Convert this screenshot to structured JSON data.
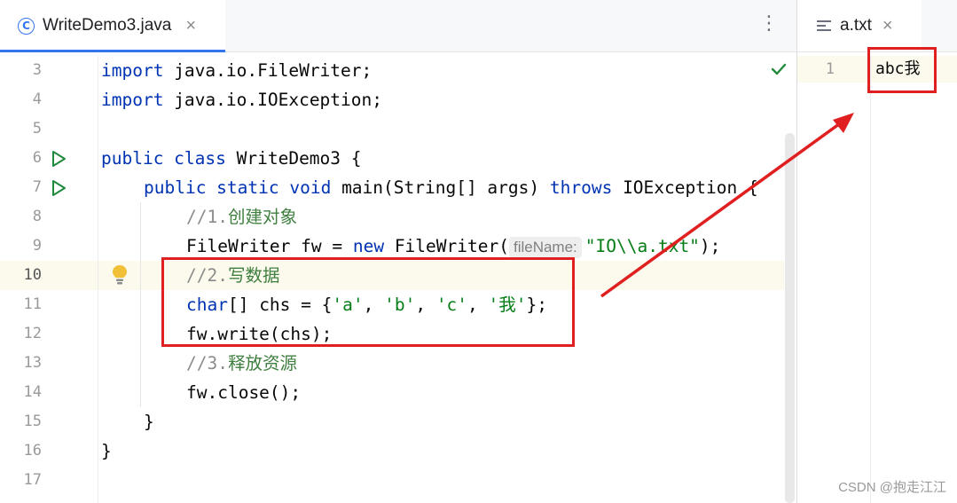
{
  "editor": {
    "tab_label": "WriteDemo3.java",
    "tab_close": "×",
    "more_icon": "⋮",
    "class_icon_letter": "C",
    "gutter_lines": [
      "3",
      "4",
      "5",
      "6",
      "7",
      "8",
      "9",
      "10",
      "11",
      "12",
      "13",
      "14",
      "15",
      "16",
      "17"
    ],
    "code": {
      "l3_kw": "import",
      "l3_rest": " java.io.FileWriter;",
      "l4_kw": "import",
      "l4_rest": " java.io.IOException;",
      "l6_kw": "public class",
      "l6_rest": " WriteDemo3 {",
      "l7_kw1": "public static void",
      "l7_mid": " main(String[] args) ",
      "l7_kw2": "throws",
      "l7_rest": " IOException {",
      "l8_prefix": "//1.",
      "l8_cn": "创建对象",
      "l9_a": "FileWriter fw = ",
      "l9_new": "new",
      "l9_b": " FileWriter(",
      "l9_hint": "fileName:",
      "l9_str": "\"IO\\\\a.txt\"",
      "l9_end": ");",
      "l10_prefix": "//2.",
      "l10_cn": "写数据",
      "l11_kw": "char",
      "l11_a": "[] chs = {",
      "l11_s1": "'a'",
      "l11_s2": "'b'",
      "l11_s3": "'c'",
      "l11_s4": "'我'",
      "l11_sep": ", ",
      "l11_end": "};",
      "l12": "fw.write(chs);",
      "l13_prefix": "//3.",
      "l13_cn": "释放资源",
      "l14": "fw.close();",
      "l15": "}",
      "l16": "}"
    }
  },
  "preview": {
    "tab_label": "a.txt",
    "tab_close": "×",
    "line_number": "1",
    "content": "abc我"
  },
  "watermark": "CSDN @抱走江江",
  "colors": {
    "accent": "#3574f0",
    "keyword": "#0033b3",
    "string": "#067d17",
    "annotation_red": "#e02020",
    "run_green": "#208a3c"
  }
}
